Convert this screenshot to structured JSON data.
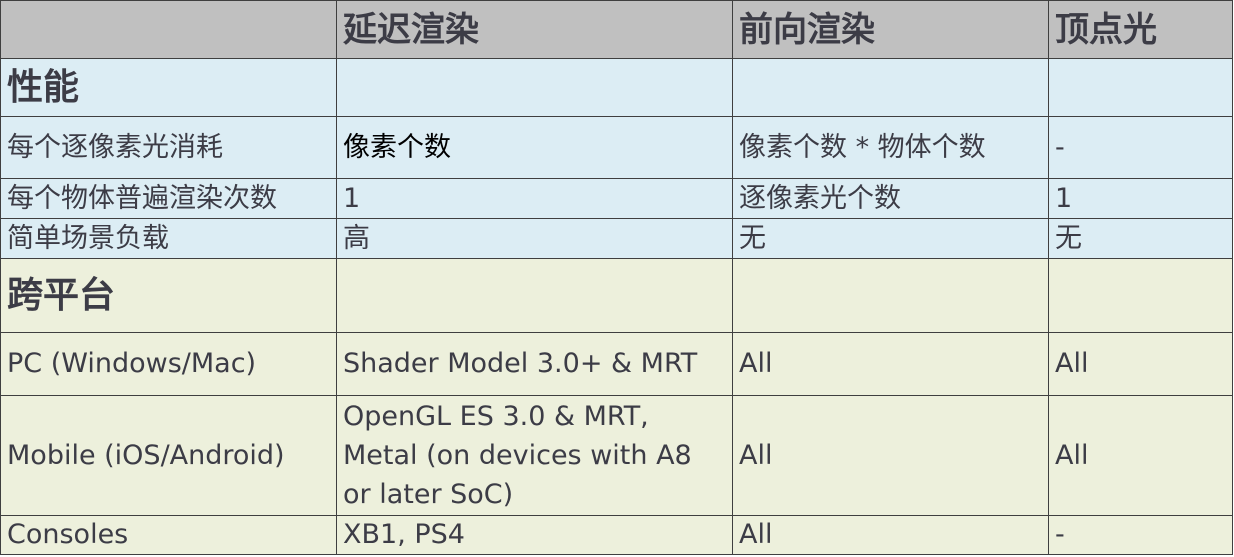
{
  "header": {
    "c0": "",
    "c1": "延迟渲染",
    "c2": "前向渲染",
    "c3": "顶点光"
  },
  "performance": {
    "title": "性能",
    "rows": [
      {
        "label": "每个逐像素光消耗",
        "deferred": "像素个数",
        "forward": "像素个数 * 物体个数",
        "vertex": "-"
      },
      {
        "label": "每个物体普遍渲染次数",
        "deferred": "1",
        "forward": "逐像素光个数",
        "vertex": "1"
      },
      {
        "label": "简单场景负载",
        "deferred": "高",
        "forward": "无",
        "vertex": "无"
      }
    ]
  },
  "platform": {
    "title": "跨平台",
    "rows": [
      {
        "label": "PC (Windows/Mac)",
        "deferred": "Shader Model 3.0+ & MRT",
        "forward": "All",
        "vertex": "All"
      },
      {
        "label": "Mobile (iOS/Android)",
        "deferred": "OpenGL ES 3.0 & MRT, Metal (on devices with A8 or later SoC)",
        "forward": "All",
        "vertex": "All"
      },
      {
        "label": "Consoles",
        "deferred": "XB1, PS4",
        "forward": "All",
        "vertex": "-"
      }
    ]
  },
  "colors": {
    "header_bg": "#c0c0c0",
    "performance_bg": "#dcedf4",
    "platform_bg": "#edf0dc",
    "text": "#3c3c46",
    "border": "#3f3f3f"
  }
}
